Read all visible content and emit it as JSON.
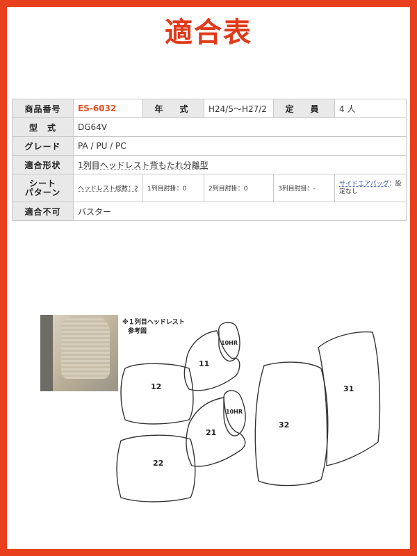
{
  "title": "適合表",
  "spec": {
    "product_no_label": "商品番号",
    "product_no": "ES-6032",
    "year_label": "年　式",
    "year": "H24/5～H27/2",
    "capacity_label": "定　員",
    "capacity": "4 人",
    "model_label": "型　式",
    "model": "DG64V",
    "grade_label": "グレード",
    "grade": "PA / PU / PC",
    "shape_label": "適合形状",
    "shape": "1列目ヘッドレスト背もたれ分離型",
    "pattern_label_1": "シート",
    "pattern_label_2": "パターン",
    "headrest_total": "ヘッドレスト総数：2",
    "row1": "1列目肘掛：0",
    "row2": "2列目肘掛：0",
    "row3": "3列目肘掛：-",
    "airbag_link": "サイドエアバッグ",
    "airbag_rest": "：設定なし",
    "incompatible_label": "適合不可",
    "incompatible": "バスター"
  },
  "diagram": {
    "note_line1": "※１列目ヘッドレスト",
    "note_line2": "参考図",
    "labels": {
      "p10hr_a": "10HR",
      "p10hr_b": "10HR",
      "p11": "11",
      "p12": "12",
      "p21": "21",
      "p22": "22",
      "p31": "31",
      "p32": "32"
    }
  },
  "colors": {
    "frame": "#e8401c",
    "title": "#e03a1a",
    "code": "#e8501e"
  }
}
